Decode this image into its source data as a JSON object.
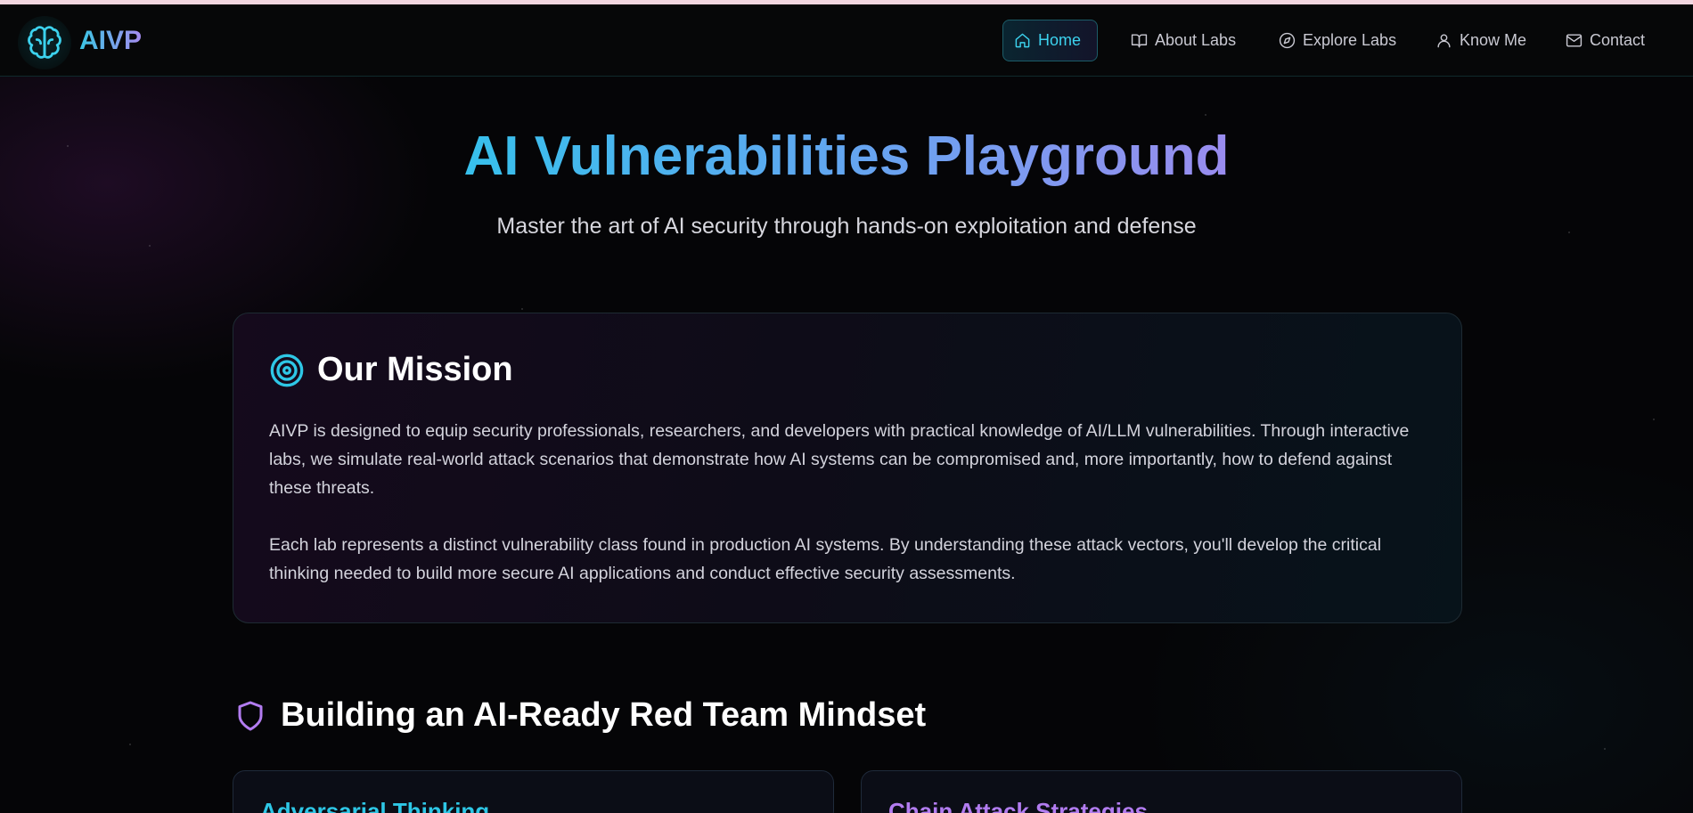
{
  "brand": {
    "name": "AIVP",
    "logo_icon": "brain-icon"
  },
  "nav": {
    "items": [
      {
        "label": "Home",
        "icon": "home-icon",
        "active": true
      },
      {
        "label": "About Labs",
        "icon": "book-icon",
        "active": false
      },
      {
        "label": "Explore Labs",
        "icon": "compass-icon",
        "active": false
      },
      {
        "label": "Know Me",
        "icon": "user-icon",
        "active": false
      },
      {
        "label": "Contact",
        "icon": "mail-icon",
        "active": false
      }
    ]
  },
  "hero": {
    "title": "AI Vulnerabilities Playground",
    "subtitle": "Master the art of AI security through hands-on exploitation and defense"
  },
  "mission": {
    "icon": "target-icon",
    "title": "Our Mission",
    "paragraphs": [
      "AIVP is designed to equip security professionals, researchers, and developers with practical knowledge of AI/LLM vulnerabilities. Through interactive labs, we simulate real-world attack scenarios that demonstrate how AI systems can be compromised and, more importantly, how to defend against these threats.",
      "Each lab represents a distinct vulnerability class found in production AI systems. By understanding these attack vectors, you'll develop the critical thinking needed to build more secure AI applications and conduct effective security assessments."
    ]
  },
  "mindset": {
    "icon": "shield-icon",
    "title": "Building an AI-Ready Red Team Mindset",
    "cards": [
      {
        "title": "Adversarial Thinking",
        "color": "#2ec7e6"
      },
      {
        "title": "Chain Attack Strategies",
        "color": "#b27cf0"
      }
    ]
  },
  "colors": {
    "accent_cyan": "#3cd2ee",
    "accent_purple": "#a68bf0",
    "background": "#050507"
  }
}
